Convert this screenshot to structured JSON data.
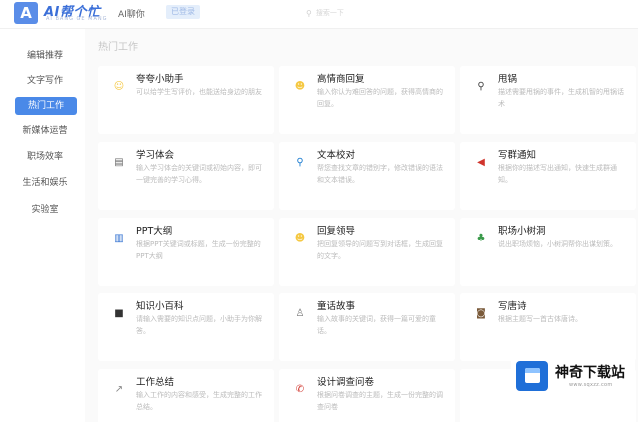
{
  "header": {
    "logo_mark": "A",
    "app_title": "AI帮个忙",
    "app_subtitle": "AI BANG GE MANG",
    "nav_link": "AI聊你",
    "badge": "已登录",
    "search_placeholder": "搜索一下"
  },
  "sidebar": {
    "items": [
      {
        "label": "编辑推荐",
        "active": false
      },
      {
        "label": "文字写作",
        "active": false
      },
      {
        "label": "热门工作",
        "active": true
      },
      {
        "label": "新媒体运营",
        "active": false
      },
      {
        "label": "职场效率",
        "active": false
      },
      {
        "label": "生活和娱乐",
        "active": false
      },
      {
        "label": "实验室",
        "active": false
      }
    ]
  },
  "main": {
    "section_title": "热门工作",
    "cards": [
      {
        "title": "夸夸小助手",
        "desc": "可以给学生写评价，也能送给身边的朋友",
        "icon": "smile-icon",
        "glyph": "☺",
        "color": "#f5c842"
      },
      {
        "title": "高情商回复",
        "desc": "输入你认为难回答的问题，获得高情商的回复。",
        "icon": "emoji-icon",
        "glyph": "☻",
        "color": "#f5c842"
      },
      {
        "title": "甩锅",
        "desc": "描述需要甩锅的事件，生成机智的甩锅话术",
        "icon": "magnifier-icon",
        "glyph": "⚲",
        "color": "#444444"
      },
      {
        "title": "学习体会",
        "desc": "输入学习体会的关键词或初始内容，即可一键完善的学习心得。",
        "icon": "book-icon",
        "glyph": "▤",
        "color": "#666666"
      },
      {
        "title": "文本校对",
        "desc": "帮您查找文章的错别字，修改错误的语法和文本错误。",
        "icon": "search-doc-icon",
        "glyph": "⚲",
        "color": "#1a7bd0"
      },
      {
        "title": "写群通知",
        "desc": "根据你的描述写出通知，快速生成群通知。",
        "icon": "megaphone-icon",
        "glyph": "◀",
        "color": "#d0342c"
      },
      {
        "title": "PPT大纲",
        "desc": "根据PPT关键词或标题，生成一份完整的PPT大纲",
        "icon": "chart-icon",
        "glyph": "▥",
        "color": "#2f6fd0"
      },
      {
        "title": "回复领导",
        "desc": "把回复领导的问题写到对话框，生成回复的文字。",
        "icon": "face-icon",
        "glyph": "☻",
        "color": "#f5c842"
      },
      {
        "title": "职场小树洞",
        "desc": "说出职场烦恼，小树洞帮你出谋划策。",
        "icon": "tree-icon",
        "glyph": "♣",
        "color": "#3a9a4a"
      },
      {
        "title": "知识小百科",
        "desc": "请输入需要的知识点问题，小助手为你解答。",
        "icon": "notebook-icon",
        "glyph": "■",
        "color": "#333333"
      },
      {
        "title": "童话故事",
        "desc": "输入故事的关键词，获得一篇可爱的童话。",
        "icon": "figure-icon",
        "glyph": "♙",
        "color": "#777777"
      },
      {
        "title": "写唐诗",
        "desc": "根据主题写一首古体唐诗。",
        "icon": "poem-icon",
        "glyph": "◙",
        "color": "#7a5a3a"
      },
      {
        "title": "工作总结",
        "desc": "输入工作的内容和感受，生成完整的工作总结。",
        "icon": "trend-icon",
        "glyph": "↗",
        "color": "#888888"
      },
      {
        "title": "设计调查问卷",
        "desc": "根据问卷调查的主题，生成一份完整的调查问卷",
        "icon": "phone-icon",
        "glyph": "✆",
        "color": "#d0342c"
      },
      {
        "title": "",
        "desc": "",
        "icon": "hidden-icon",
        "glyph": "",
        "color": "#cccccc"
      }
    ]
  },
  "watermark": {
    "title": "神奇下载站",
    "url": "www.sqxzz.com"
  }
}
